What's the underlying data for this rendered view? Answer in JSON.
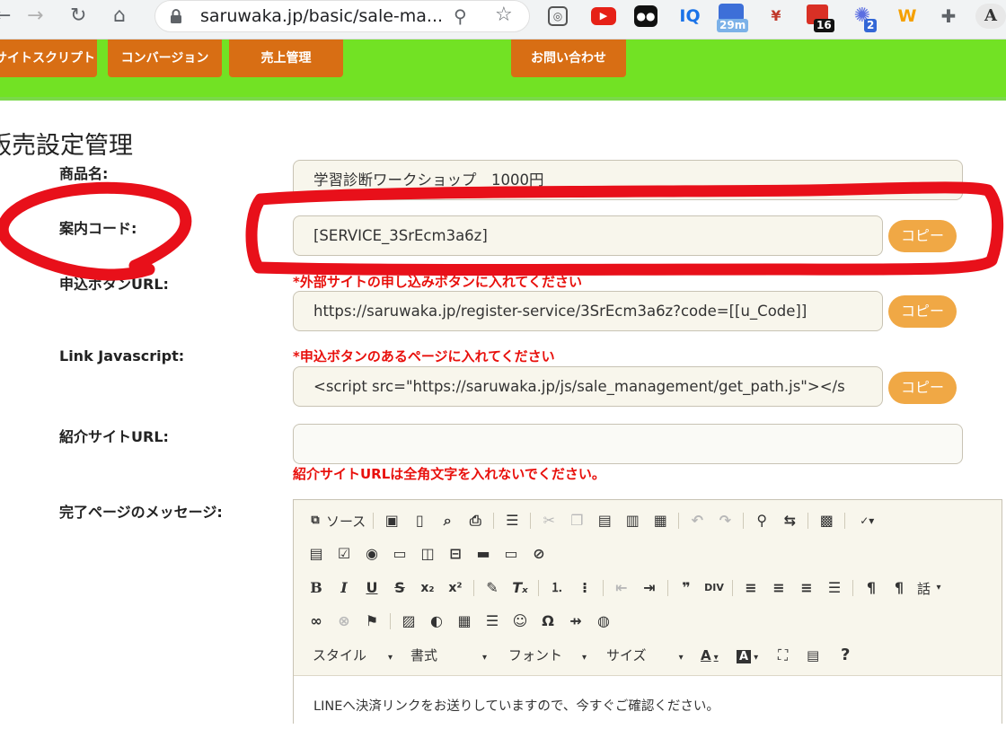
{
  "browser": {
    "url": "saruwaka.jp/basic/sale-ma...",
    "ext_badges": {
      "calendar": "29m",
      "todoist": "16",
      "ai": "2"
    },
    "ext_labels": {
      "iq": "IQ",
      "w": "W",
      "font": "A"
    }
  },
  "header": {
    "menu": [
      "サイトスクリプト",
      "コンバージョン",
      "売上管理",
      "お問い合わせ"
    ]
  },
  "page": {
    "title": "販売設定管理"
  },
  "form": {
    "product_name": {
      "label": "商品名:",
      "value": "学習診断ワークショップ　1000円"
    },
    "guide_code": {
      "label": "案内コード:",
      "value": "[SERVICE_3SrEcm3a6z]",
      "copy_label": "コピー"
    },
    "apply_url": {
      "label": "申込ボタンURL:",
      "note": "*外部サイトの申し込みボタンに入れてください",
      "value": "https://saruwaka.jp/register-service/3SrEcm3a6z?code=[[u_Code]]",
      "copy_label": "コピー"
    },
    "link_js": {
      "label": "Link Javascript:",
      "note": "*申込ボタンのあるページに入れてください",
      "value": "<script src=\"https://saruwaka.jp/js/sale_management/get_path.js\"></s",
      "copy_label": "コピー"
    },
    "intro_url": {
      "label": "紹介サイトURL:",
      "value": "",
      "note": "紹介サイトURLは全角文字を入れないでください。"
    },
    "completion_message": {
      "label": "完了ページのメッセージ:",
      "source_label": "ソース",
      "combos": [
        "スタイル",
        "書式",
        "フォント",
        "サイズ"
      ],
      "talk_label": "話",
      "body_text": "LINEへ決済リンクをお送りしていますので、今すぐご確認ください。"
    }
  },
  "colors": {
    "header_green": "#72e224",
    "menu_orange": "#d86e14",
    "copy_orange": "#f0a845",
    "warning_red": "#e8100c",
    "annotation_red": "#e8101a"
  }
}
